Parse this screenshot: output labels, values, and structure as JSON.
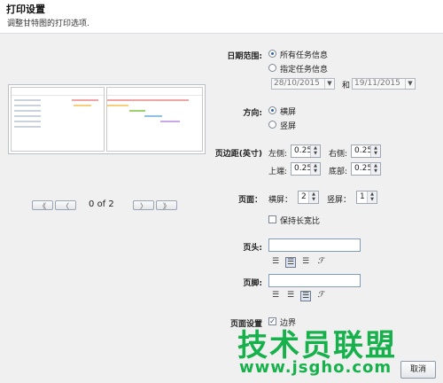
{
  "dialog": {
    "title": "打印设置",
    "subtitle": "调整甘特图的打印选项."
  },
  "pager": {
    "first_icon": "《",
    "prev_icon": "〈",
    "next_icon": "〉",
    "last_icon": "》",
    "current": "0",
    "of_label": "of",
    "total": "2"
  },
  "date_range": {
    "label": "日期范围:",
    "option_all": "所有任务信息",
    "option_specified": "指定任务信息",
    "selected": "所有任务信息",
    "start_date": "28/10/2015",
    "and_label": "和",
    "end_date": "19/11/2015"
  },
  "orientation": {
    "label": "方向:",
    "landscape": "横屏",
    "portrait": "竖屏",
    "selected": "横屏"
  },
  "margins": {
    "label": "页边距(英寸)",
    "left_label": "左侧:",
    "left_value": "0.25",
    "right_label": "右侧:",
    "right_value": "0.25",
    "top_label": "上端:",
    "top_value": "0.25",
    "bottom_label": "底部:",
    "bottom_value": "0.25"
  },
  "pages": {
    "label": "页面：",
    "horizontal_label": "横屏：",
    "horizontal_value": "2",
    "vertical_label": "竖屏：",
    "vertical_value": "1",
    "keep_aspect_label": "保持长宽比",
    "keep_aspect_checked": false
  },
  "header": {
    "label": "页头:",
    "value": ""
  },
  "footer": {
    "label": "页脚:",
    "value": ""
  },
  "page_settings": {
    "label": "页面设置",
    "border_label": "边界",
    "border_checked": true
  },
  "buttons": {
    "cancel_label": "取消"
  },
  "watermark": {
    "text": "技术员联盟",
    "url": "www.jsgho.com"
  },
  "colors": {
    "accent": "#2f5fa8",
    "watermark": "#17b14c",
    "gantt_bars": [
      "#f2a3a3",
      "#f5cf7a",
      "#9ed06f",
      "#8ec3e8",
      "#c7a7e8"
    ]
  }
}
